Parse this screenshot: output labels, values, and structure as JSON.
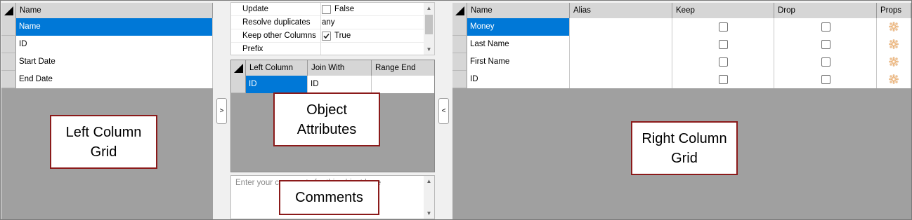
{
  "left_grid": {
    "header": "Name",
    "rows": [
      "Name",
      "ID",
      "Start Date",
      "End Date"
    ],
    "selected_index": 0,
    "callout": "Left Column Grid"
  },
  "buttons": {
    "move_right": ">",
    "move_left": "<"
  },
  "properties": {
    "rows": [
      {
        "name": "Update",
        "value": "False",
        "checkbox": true,
        "checked": false
      },
      {
        "name": "Resolve duplicates",
        "value": "any",
        "checkbox": false,
        "checked": false
      },
      {
        "name": "Keep other Columns",
        "value": "True",
        "checkbox": true,
        "checked": true
      },
      {
        "name": "Prefix",
        "value": "",
        "checkbox": false,
        "checked": false
      }
    ]
  },
  "join_grid": {
    "headers": [
      "Left Column",
      "Join With",
      "Range End"
    ],
    "rows": [
      [
        "ID",
        "ID",
        ""
      ]
    ],
    "callout": "Object Attributes"
  },
  "comments": {
    "placeholder": "Enter your comments for this object here",
    "callout": "Comments"
  },
  "right_grid": {
    "headers": [
      "Name",
      "Alias",
      "Keep",
      "Drop",
      "Props"
    ],
    "rows": [
      {
        "name": "Money",
        "alias": "",
        "keep": false,
        "drop": false
      },
      {
        "name": "Last Name",
        "alias": "",
        "keep": false,
        "drop": false
      },
      {
        "name": "First Name",
        "alias": "",
        "keep": false,
        "drop": false
      },
      {
        "name": "ID",
        "alias": "",
        "keep": false,
        "drop": false
      }
    ],
    "selected_index": 0,
    "callout": "Right Column Grid"
  },
  "colors": {
    "selection": "#0078d7",
    "callout_border": "#8b1a1a",
    "grid_background": "#a0a0a0"
  }
}
